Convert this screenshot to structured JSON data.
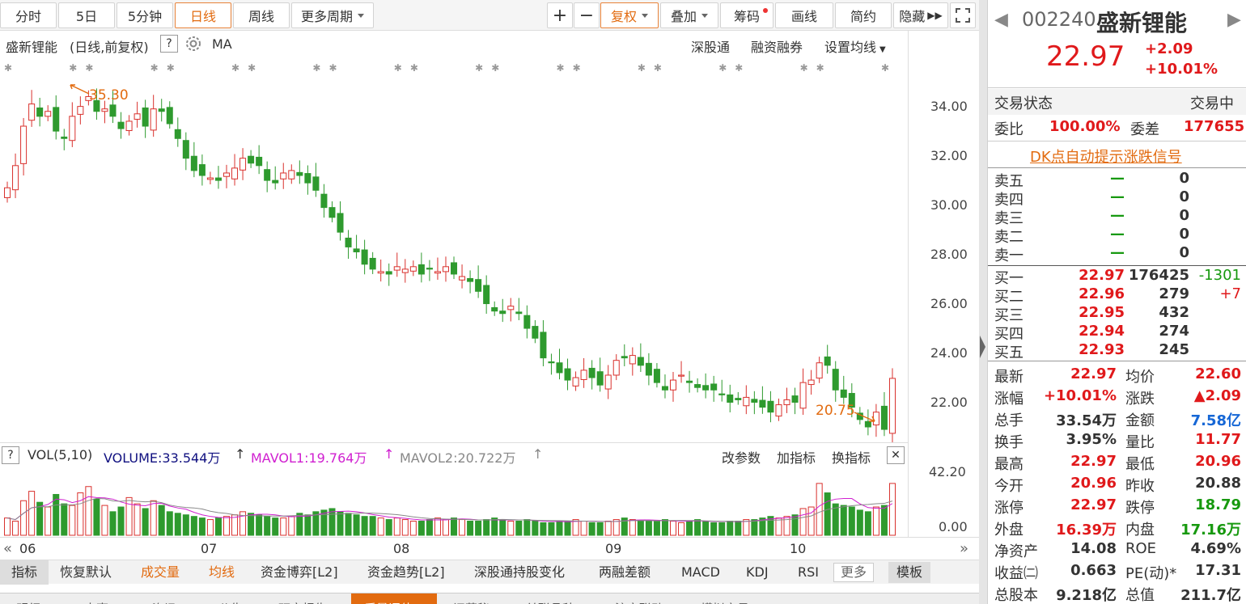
{
  "toolbar": {
    "periods": [
      "分时",
      "5日",
      "5分钟",
      "日线",
      "周线",
      "更多周期"
    ],
    "plus": "+",
    "minus": "−",
    "fuquan": "复权",
    "diejia": "叠加",
    "chouma": "筹码",
    "huaxian": "画线",
    "jianyue": "简约",
    "yincang": "隐藏"
  },
  "chart_header": {
    "name": "盛新锂能",
    "mode": "(日线,前复权)",
    "help": "?",
    "indicator": "MA",
    "links": [
      "深股通",
      "融资融券",
      "设置均线"
    ]
  },
  "price_axis": [
    "34.00",
    "32.00",
    "30.00",
    "28.00",
    "26.00",
    "24.00",
    "22.00"
  ],
  "annotations": {
    "high": "35.30",
    "low": "20.75"
  },
  "volume_header": {
    "help": "?",
    "label": "VOL(5,10)",
    "volume": "VOLUME:33.544万",
    "mavol1": "MAVOL1:19.764万",
    "mavol2": "MAVOL2:20.722万",
    "links": [
      "改参数",
      "加指标",
      "换指标"
    ],
    "close": "✕"
  },
  "volume_axis": [
    "42.20",
    "0.00"
  ],
  "date_axis": [
    "06",
    "07",
    "08",
    "09",
    "10"
  ],
  "indicator_tabs": [
    "指标",
    "恢复默认",
    "成交量",
    "均线",
    "资金博弈[L2]",
    "资金趋势[L2]",
    "深股通持股变化",
    "两融差额",
    "MACD",
    "KDJ",
    "RSI",
    "更多",
    "模板"
  ],
  "bottom_tabs": [
    "明细",
    "大事",
    "资讯",
    "公告",
    "研究报告",
    "质量评估",
    "问董秘",
    "关联品种",
    "沪市联动",
    "模拟交易"
  ],
  "quote": {
    "code": "002240",
    "name": "盛新锂能",
    "price": "22.97",
    "change": "+2.09",
    "pct": "+10.01%",
    "status_label": "交易状态",
    "status_value": "交易中",
    "weibi_label": "委比",
    "weibi_value": "100.00%",
    "weicha_label": "委差",
    "weicha_value": "177655",
    "dk_link": "DK点自动提示涨跌信号",
    "sell": [
      {
        "label": "卖五",
        "price": "—",
        "vol": "0"
      },
      {
        "label": "卖四",
        "price": "—",
        "vol": "0"
      },
      {
        "label": "卖三",
        "price": "—",
        "vol": "0"
      },
      {
        "label": "卖二",
        "price": "—",
        "vol": "0"
      },
      {
        "label": "卖一",
        "price": "—",
        "vol": "0"
      }
    ],
    "buy": [
      {
        "label": "买一",
        "price": "22.97",
        "vol": "176425",
        "chg": "-1301"
      },
      {
        "label": "买二",
        "price": "22.96",
        "vol": "279",
        "chg": "+7"
      },
      {
        "label": "买三",
        "price": "22.95",
        "vol": "432",
        "chg": ""
      },
      {
        "label": "买四",
        "price": "22.94",
        "vol": "274",
        "chg": ""
      },
      {
        "label": "买五",
        "price": "22.93",
        "vol": "245",
        "chg": ""
      }
    ],
    "stats": [
      {
        "l1": "最新",
        "v1": "22.97",
        "c1": "red",
        "l2": "均价",
        "v2": "22.60",
        "c2": "red"
      },
      {
        "l1": "涨幅",
        "v1": "+10.01%",
        "c1": "red",
        "l2": "涨跌",
        "v2": "▲2.09",
        "c2": "red"
      },
      {
        "l1": "总手",
        "v1": "33.54万",
        "c1": "",
        "l2": "金额",
        "v2": "7.58亿",
        "c2": "blue"
      },
      {
        "l1": "换手",
        "v1": "3.95%",
        "c1": "",
        "l2": "量比",
        "v2": "11.77",
        "c2": "red"
      },
      {
        "l1": "最高",
        "v1": "22.97",
        "c1": "red",
        "l2": "最低",
        "v2": "20.96",
        "c2": "red"
      },
      {
        "l1": "今开",
        "v1": "20.96",
        "c1": "red",
        "l2": "昨收",
        "v2": "20.88",
        "c2": ""
      },
      {
        "l1": "涨停",
        "v1": "22.97",
        "c1": "red",
        "l2": "跌停",
        "v2": "18.79",
        "c2": "green"
      },
      {
        "l1": "外盘",
        "v1": "16.39万",
        "c1": "red",
        "l2": "内盘",
        "v2": "17.16万",
        "c2": "green"
      },
      {
        "l1": "净资产",
        "v1": "14.08",
        "c1": "",
        "l2": "ROE",
        "v2": "4.69%",
        "c2": ""
      },
      {
        "l1": "收益㈡",
        "v1": "0.663",
        "c1": "",
        "l2": "PE(动)*",
        "v2": "17.31",
        "c2": ""
      },
      {
        "l1": "总股本",
        "v1": "9.218亿",
        "c1": "",
        "l2": "总值",
        "v2": "211.7亿",
        "c2": ""
      }
    ]
  },
  "chart_data": {
    "type": "candlestick",
    "ylim": [
      21,
      35.3
    ],
    "vol_max": 42.2,
    "close_series": [
      30.7,
      31.6,
      33.2,
      34.1,
      33.6,
      33.8,
      33.0,
      32.7,
      33.6,
      34.0,
      34.4,
      33.8,
      33.9,
      33.6,
      33.1,
      33.4,
      33.7,
      33.2,
      33.9,
      33.8,
      33.3,
      32.7,
      31.9,
      31.4,
      31.2,
      31.1,
      31.0,
      31.3,
      31.5,
      31.9,
      31.7,
      31.6,
      31.0,
      30.9,
      31.3,
      31.4,
      31.2,
      30.9,
      30.6,
      29.9,
      29.5,
      28.9,
      28.3,
      28.1,
      27.6,
      27.4,
      27.3,
      27.2,
      27.5,
      27.4,
      27.5,
      27.2,
      27.4,
      27.3,
      27.5,
      27.2,
      27.1,
      26.9,
      26.5,
      26.0,
      25.7,
      25.6,
      25.9,
      25.6,
      25.0,
      24.6,
      23.8,
      23.6,
      23.2,
      22.9,
      23.0,
      23.3,
      23.0,
      22.7,
      23.1,
      23.7,
      23.8,
      23.9,
      23.5,
      23.1,
      22.8,
      22.5,
      22.9,
      23.1,
      22.8,
      22.6,
      22.5,
      22.5,
      22.3,
      22.0,
      22.1,
      22.2,
      22.0,
      21.8,
      21.6,
      21.9,
      22.1,
      22.0,
      22.8,
      22.9,
      23.6,
      23.5,
      22.5,
      22.2,
      21.8,
      21.3,
      21.0,
      21.6,
      20.9,
      22.97
    ],
    "volume_series": [
      11,
      9,
      22,
      28,
      21,
      18,
      26,
      20,
      19,
      27,
      31,
      23,
      19,
      15,
      18,
      24,
      20,
      17,
      22,
      19,
      15,
      14,
      13,
      12,
      11,
      10,
      11,
      12,
      13,
      15,
      14,
      13,
      12,
      11,
      11,
      12,
      14,
      13,
      15,
      16,
      17,
      15,
      14,
      13,
      12,
      12,
      11,
      10,
      11,
      10,
      9,
      9,
      10,
      11,
      10,
      11,
      10,
      9,
      9,
      10,
      11,
      10,
      9,
      9,
      10,
      9,
      8,
      8,
      9,
      9,
      10,
      9,
      8,
      8,
      9,
      10,
      11,
      10,
      9,
      9,
      9,
      10,
      9,
      8,
      9,
      10,
      9,
      8,
      8,
      9,
      9,
      10,
      10,
      11,
      12,
      11,
      12,
      13,
      17,
      18,
      33,
      27,
      20,
      19,
      18,
      16,
      15,
      18,
      19,
      33
    ]
  }
}
